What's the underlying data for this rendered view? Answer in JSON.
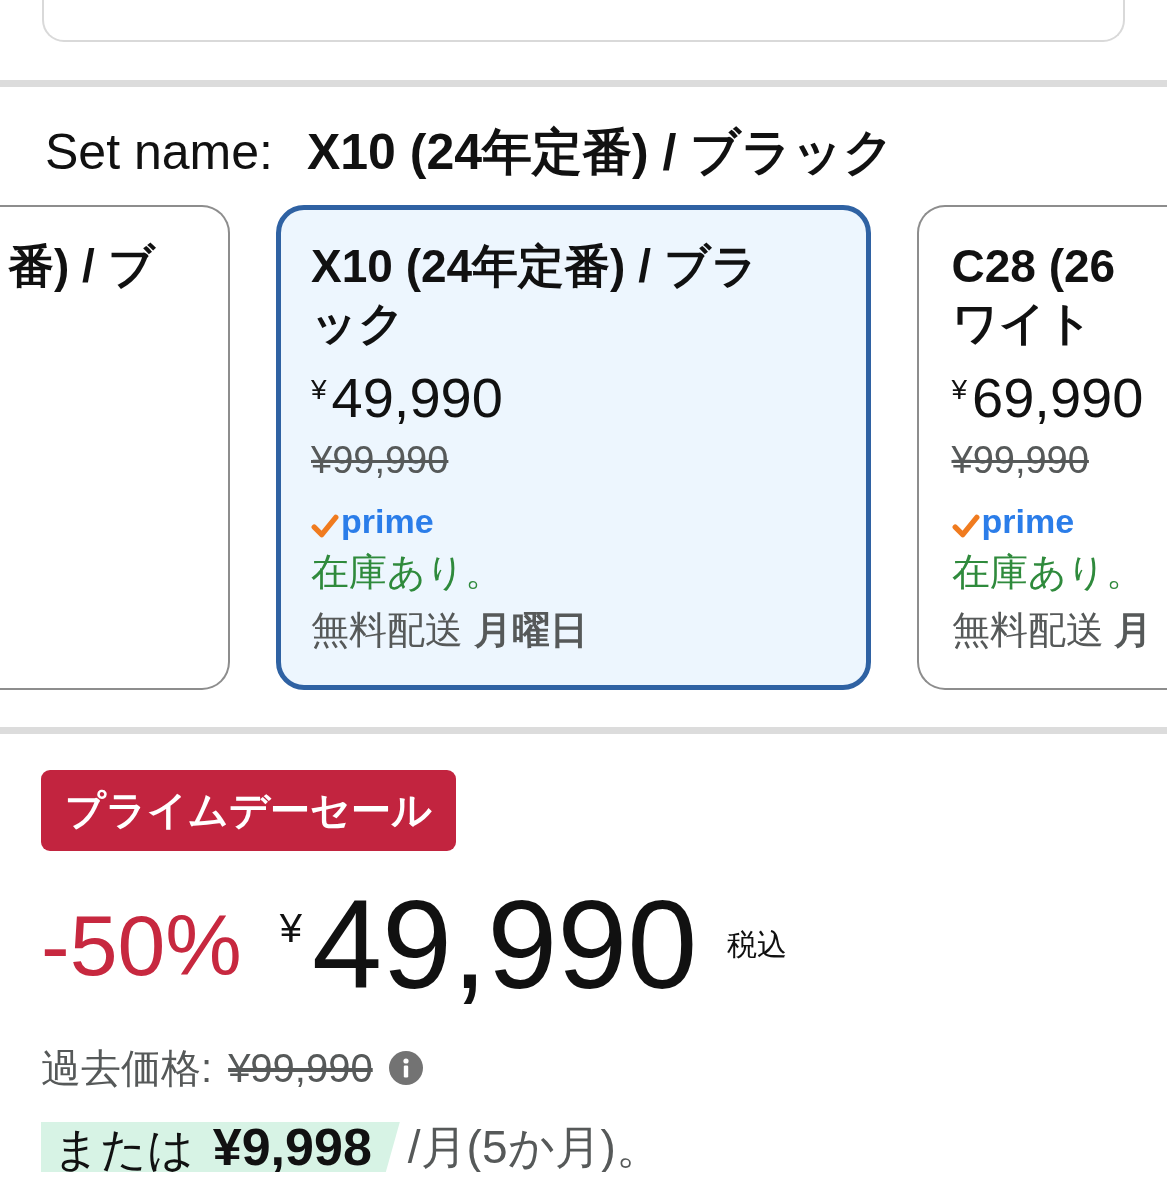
{
  "set_name": {
    "label": "Set name:",
    "value": "X10 (24年定番) / ブラック"
  },
  "variants": [
    {
      "title": "番) / ブ",
      "selected": false
    },
    {
      "title": "X10 (24年定番) / ブラック",
      "price": "$^{¥}$49,990",
      "list_price": "¥99,990",
      "prime_label": "prime",
      "availability": "在庫あり。",
      "delivery": "無料配送 **月曜日**",
      "selected": true
    },
    {
      "title_lines": [
        "C28 (26",
        "ワイト"
      ],
      "price": "$^{¥}$69,990",
      "list_price": "¥99,990",
      "prime_label": "prime",
      "availability": "在庫あり。",
      "delivery": "無料配送 **月**",
      "selected": false
    }
  ],
  "deal": {
    "badge": "プライムデーセール",
    "discount": "-50%",
    "price": "$^{¥}$49,990",
    "tax_note": "税込",
    "past_price_label": "過去価格:",
    "past_price": "¥99,990",
    "installment": "または **¥9,998**",
    "installment_term": "/月(5か月)。"
  }
}
